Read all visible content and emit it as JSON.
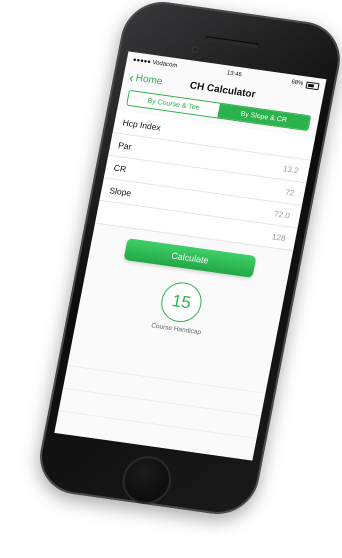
{
  "status": {
    "carrier": "●●●●● Vodacom",
    "time": "13:46",
    "battery": "68%"
  },
  "nav": {
    "back_label": "Home",
    "title": "CH Calculator"
  },
  "segments": [
    {
      "label": "By Course & Tee",
      "selected": false
    },
    {
      "label": "By Slope & CR",
      "selected": true
    }
  ],
  "fields": [
    {
      "label": "Hcp Index",
      "value": ""
    },
    {
      "label": "Par",
      "value": "13.2"
    },
    {
      "label": "CR",
      "value": "72"
    },
    {
      "label": "Slope",
      "value": "72.0"
    },
    {
      "label": "",
      "value": "128"
    }
  ],
  "calculate_label": "Calculate",
  "result": {
    "value": "15",
    "label": "Course Handicap"
  },
  "colors": {
    "accent": "#2bb24c",
    "phone_body": "#111111"
  }
}
